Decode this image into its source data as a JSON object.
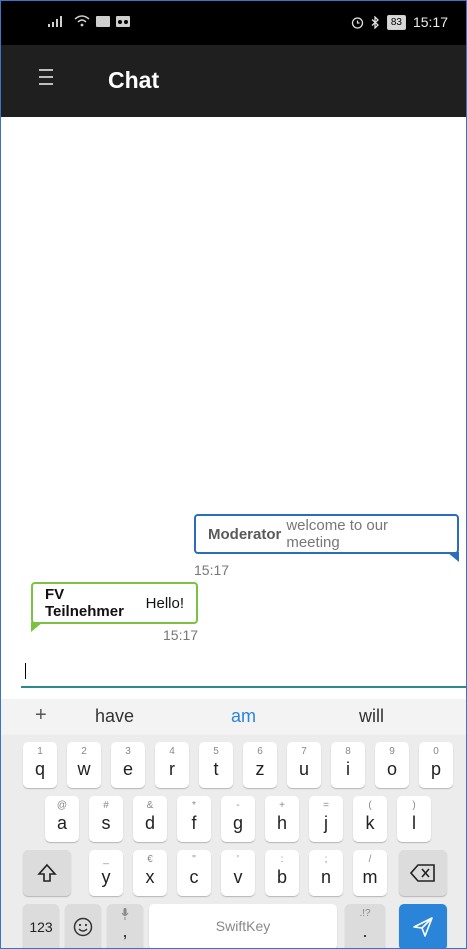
{
  "status_bar": {
    "battery": "83",
    "time": "15:17"
  },
  "app_bar": {
    "title": "Chat"
  },
  "messages": [
    {
      "sender": "Moderator",
      "text": "welcome to our meeting",
      "time": "15:17"
    },
    {
      "sender": "FV Teilnehmer",
      "text": "Hello!",
      "time": "15:17"
    }
  ],
  "colors": {
    "outgoing_border": "#2a6dbb",
    "incoming_border": "#7bc142",
    "input_underline": "#2b8a8a",
    "suggestion_highlight": "#2a84d8",
    "send_key": "#2a84d8"
  },
  "keyboard": {
    "suggestions": [
      "have",
      "am",
      "will"
    ],
    "plus": "+",
    "row1": [
      {
        "key": "q",
        "sub": "1"
      },
      {
        "key": "w",
        "sub": "2"
      },
      {
        "key": "e",
        "sub": "3"
      },
      {
        "key": "r",
        "sub": "4"
      },
      {
        "key": "t",
        "sub": "5"
      },
      {
        "key": "z",
        "sub": "6"
      },
      {
        "key": "u",
        "sub": "7"
      },
      {
        "key": "i",
        "sub": "8"
      },
      {
        "key": "o",
        "sub": "9"
      },
      {
        "key": "p",
        "sub": "0"
      }
    ],
    "row2": [
      {
        "key": "a",
        "sub": "@"
      },
      {
        "key": "s",
        "sub": "#"
      },
      {
        "key": "d",
        "sub": "&"
      },
      {
        "key": "f",
        "sub": "*"
      },
      {
        "key": "g",
        "sub": "-"
      },
      {
        "key": "h",
        "sub": "+"
      },
      {
        "key": "j",
        "sub": "="
      },
      {
        "key": "k",
        "sub": "("
      },
      {
        "key": "l",
        "sub": ")"
      }
    ],
    "row3": [
      {
        "key": "y",
        "sub": "_"
      },
      {
        "key": "x",
        "sub": "€"
      },
      {
        "key": "c",
        "sub": "\""
      },
      {
        "key": "v",
        "sub": "'"
      },
      {
        "key": "b",
        "sub": ":"
      },
      {
        "key": "n",
        "sub": ";"
      },
      {
        "key": "m",
        "sub": "/"
      }
    ],
    "numbers_key": "123",
    "comma_key": ",",
    "space_brand": "SwiftKey",
    "period_key": ".",
    "period_sub": ".!?",
    "icons": [
      "menu-icon",
      "shift-icon",
      "backspace-icon",
      "emoji-icon",
      "mic-icon",
      "send-icon"
    ]
  }
}
